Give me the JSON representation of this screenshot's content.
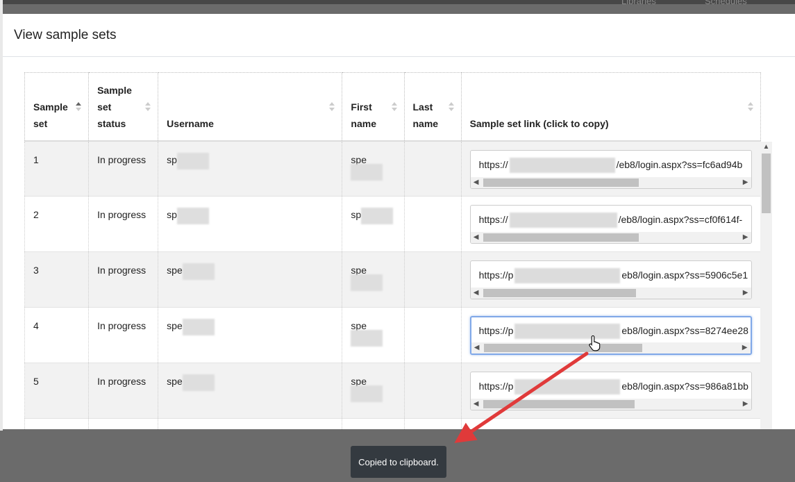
{
  "modal": {
    "title": "View sample sets"
  },
  "table": {
    "headers": [
      "Sample set",
      "Sample set status",
      "Username",
      "First name",
      "Last name",
      "Sample set link (click to copy)"
    ],
    "rows": [
      {
        "sample_set": "1",
        "status": "In progress",
        "username": "sp",
        "first_name": "spe",
        "last_name": "",
        "link_prefix": "https://",
        "link_suffix": "/eb8/login.aspx?ss=fc6ad94b"
      },
      {
        "sample_set": "2",
        "status": "In progress",
        "username": "sp",
        "first_name": "sp",
        "last_name": "",
        "link_prefix": "https://",
        "link_suffix": "/eb8/login.aspx?ss=cf0f614f-"
      },
      {
        "sample_set": "3",
        "status": "In progress",
        "username": "spe",
        "first_name": "spe",
        "last_name": "",
        "link_prefix": "https://p",
        "link_suffix": "eb8/login.aspx?ss=5906c5e1"
      },
      {
        "sample_set": "4",
        "status": "In progress",
        "username": "spe",
        "first_name": "spe",
        "last_name": "",
        "link_prefix": "https://p",
        "link_suffix": "eb8/login.aspx?ss=8274ee28"
      },
      {
        "sample_set": "5",
        "status": "In progress",
        "username": "spe",
        "first_name": "spe",
        "last_name": "",
        "link_prefix": "https://p",
        "link_suffix": "eb8/login.aspx?ss=986a81bb"
      }
    ]
  },
  "toast": {
    "message": "Copied to clipboard."
  },
  "backdrop": {
    "nav_items": [
      "Libraries",
      "Schedules"
    ]
  },
  "colors": {
    "annotation_arrow": "#e03a3a",
    "toast_bg": "#343a40",
    "focus_border": "#80a8e8"
  }
}
